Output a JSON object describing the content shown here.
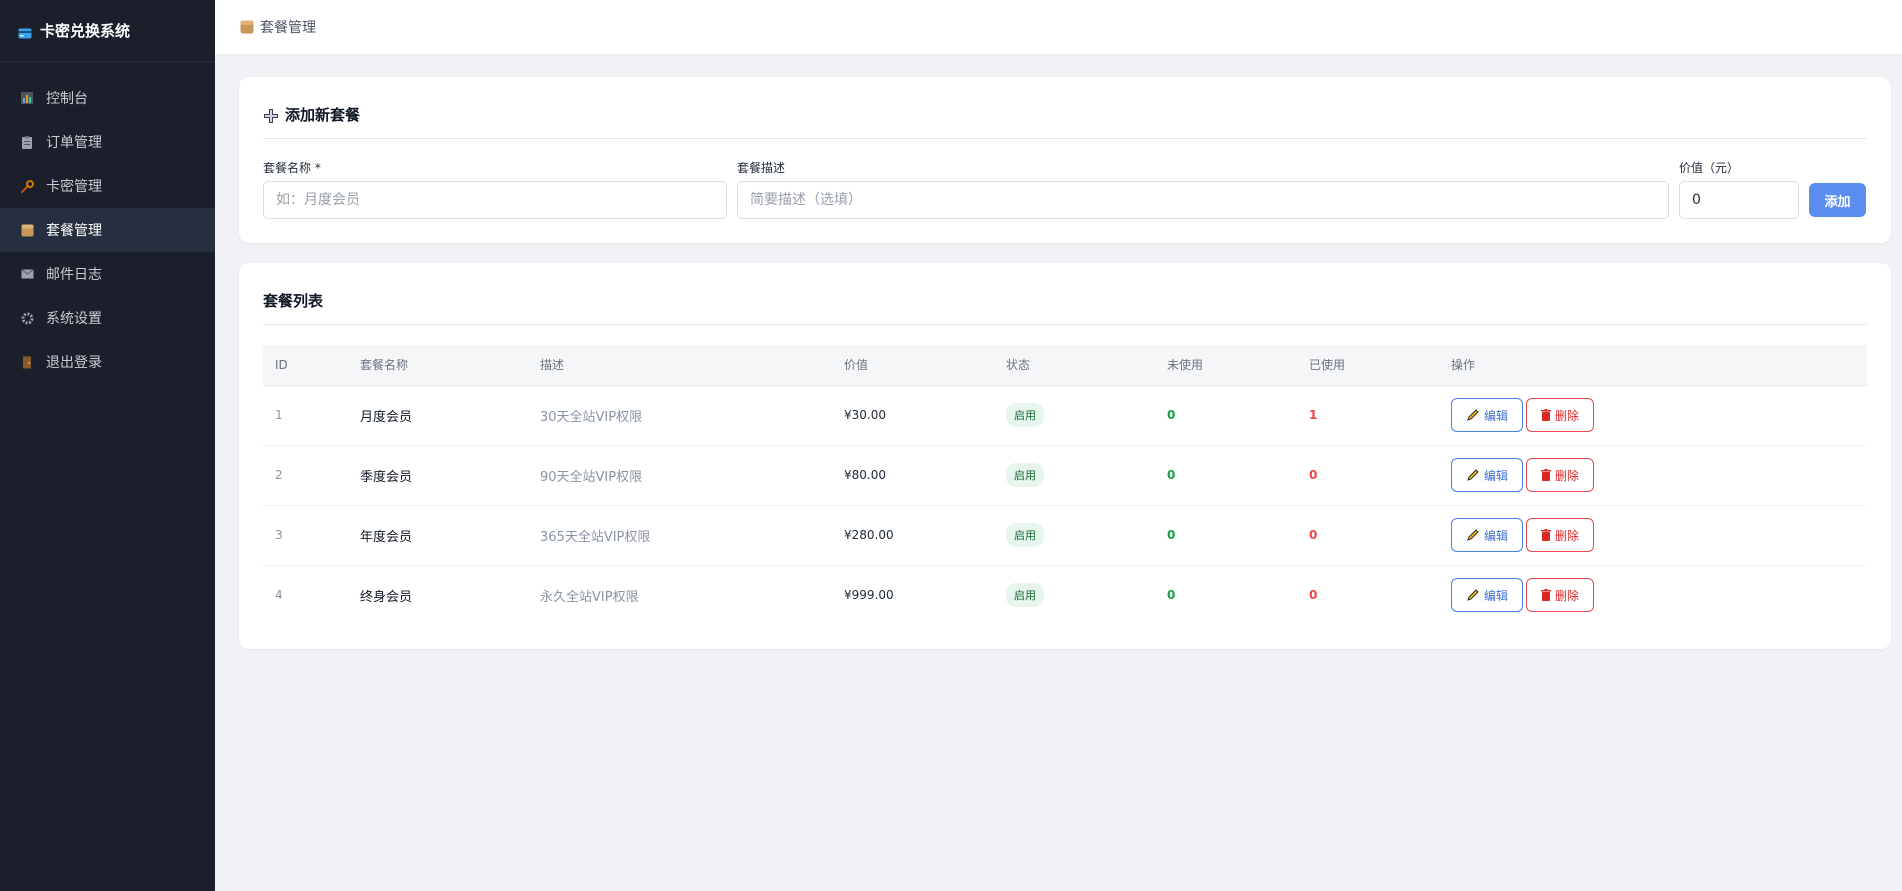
{
  "sidebar": {
    "brand": "卡密兑换系统",
    "items": [
      {
        "label": "控制台",
        "icon": "chart-icon"
      },
      {
        "label": "订单管理",
        "icon": "clipboard-icon"
      },
      {
        "label": "卡密管理",
        "icon": "wrench-icon"
      },
      {
        "label": "套餐管理",
        "icon": "package-icon",
        "active": true
      },
      {
        "label": "邮件日志",
        "icon": "mail-icon"
      },
      {
        "label": "系统设置",
        "icon": "gear-icon"
      },
      {
        "label": "退出登录",
        "icon": "door-icon"
      }
    ]
  },
  "topbar": {
    "breadcrumb": "套餐管理"
  },
  "add_form": {
    "title": "添加新套餐",
    "name_label": "套餐名称 *",
    "name_placeholder": "如：月度会员",
    "desc_label": "套餐描述",
    "desc_placeholder": "简要描述（选填）",
    "value_label": "价值（元）",
    "value_value": "0",
    "submit_label": "添加"
  },
  "list": {
    "title": "套餐列表",
    "columns": [
      "ID",
      "套餐名称",
      "描述",
      "价值",
      "状态",
      "未使用",
      "已使用",
      "操作"
    ],
    "edit_label": "编辑",
    "delete_label": "删除",
    "rows": [
      {
        "id": "1",
        "name": "月度会员",
        "desc": "30天全站VIP权限",
        "price": "¥30.00",
        "status": "启用",
        "unused": "0",
        "used": "1"
      },
      {
        "id": "2",
        "name": "季度会员",
        "desc": "90天全站VIP权限",
        "price": "¥80.00",
        "status": "启用",
        "unused": "0",
        "used": "0"
      },
      {
        "id": "3",
        "name": "年度会员",
        "desc": "365天全站VIP权限",
        "price": "¥280.00",
        "status": "启用",
        "unused": "0",
        "used": "0"
      },
      {
        "id": "4",
        "name": "终身会员",
        "desc": "永久全站VIP权限",
        "price": "¥999.00",
        "status": "启用",
        "unused": "0",
        "used": "0"
      }
    ]
  },
  "colors": {
    "sidebar_bg": "#1a1f2b",
    "primary": "#5b8def",
    "success": "#16a34a",
    "danger": "#ef4444"
  }
}
